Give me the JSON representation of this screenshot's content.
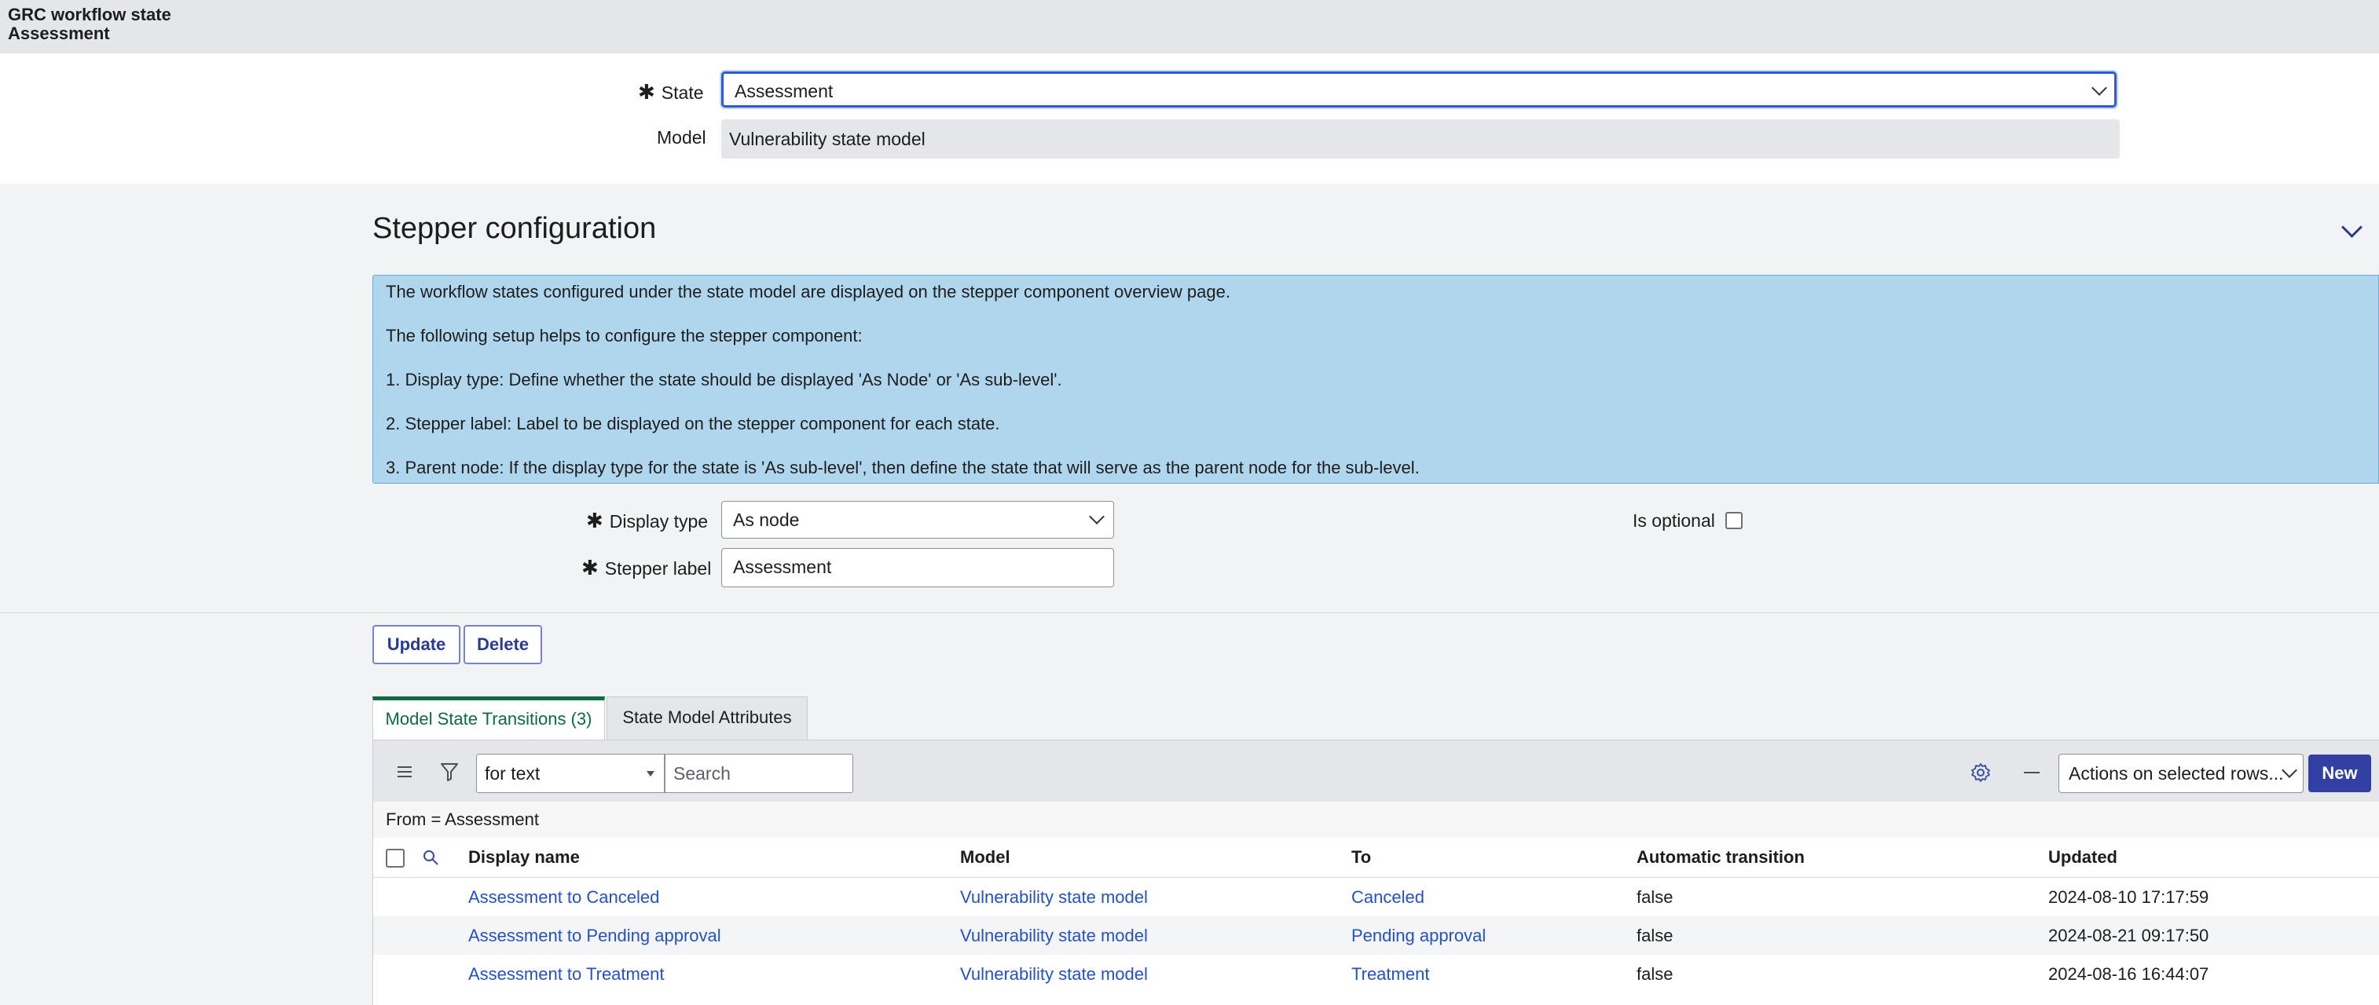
{
  "header": {
    "title": "GRC workflow state",
    "subtitle": "Assessment"
  },
  "form": {
    "state": {
      "label": "State",
      "value": "Assessment"
    },
    "model": {
      "label": "Model",
      "value": "Vulnerability state model"
    }
  },
  "stepper": {
    "title": "Stepper configuration",
    "info": [
      "The workflow states configured under the state model are displayed on the stepper component overview page.",
      "The following setup helps to configure the stepper component:",
      "1. Display type: Define whether the state should be displayed 'As Node' or 'As sub-level'.",
      "2. Stepper label: Label to be displayed on the stepper component for each state.",
      "3. Parent node: If the display type for the state is 'As sub-level', then define the state that will serve as the parent node for the sub-level."
    ],
    "display_type": {
      "label": "Display type",
      "value": "As node"
    },
    "is_optional": {
      "label": "Is optional",
      "checked": false
    },
    "stepper_label": {
      "label": "Stepper label",
      "value": "Assessment"
    }
  },
  "buttons": {
    "update": "Update",
    "delete": "Delete"
  },
  "tabs": [
    {
      "label": "Model State Transitions (3)",
      "active": true
    },
    {
      "label": "State Model Attributes",
      "active": false
    }
  ],
  "list": {
    "search_field": "for text",
    "search_placeholder": "Search",
    "actions": "Actions on selected rows...",
    "new_button": "New",
    "filter": "From = Assessment",
    "columns": [
      "Display name",
      "Model",
      "To",
      "Automatic transition",
      "Updated"
    ],
    "rows": [
      {
        "display_name": "Assessment to Canceled",
        "model": "Vulnerability state model",
        "to": "Canceled",
        "automatic": "false",
        "updated": "2024-08-10 17:17:59"
      },
      {
        "display_name": "Assessment to Pending approval",
        "model": "Vulnerability state model",
        "to": "Pending approval",
        "automatic": "false",
        "updated": "2024-08-21 09:17:50"
      },
      {
        "display_name": "Assessment to Treatment",
        "model": "Vulnerability state model",
        "to": "Treatment",
        "automatic": "false",
        "updated": "2024-08-16 16:44:07"
      }
    ]
  },
  "colors": {
    "primary": "#2b3a8c",
    "link": "#2451c6",
    "active_tab": "#0c6b3f",
    "info_bg": "#afd6ec"
  },
  "icons": [
    "list-menu-icon",
    "filter-icon",
    "search-icon",
    "gear-icon",
    "minus-icon",
    "chevron-down-icon"
  ]
}
